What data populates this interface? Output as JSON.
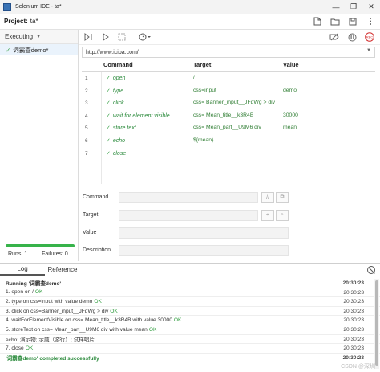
{
  "window": {
    "title": "Selenium IDE - ta*",
    "minimize": "—",
    "restore": "❐",
    "close": "✕"
  },
  "project": {
    "label": "Project:",
    "name": "ta*"
  },
  "sidebar": {
    "header": "Executing",
    "tests": [
      {
        "label": "词霸查demo*",
        "status": "passed"
      }
    ],
    "runs_label": "Runs: 1",
    "failures_label": "Failures: 0",
    "progress_fraction": 1.0
  },
  "url": {
    "value": "http://www.iciba.com/"
  },
  "table": {
    "headers": {
      "command": "Command",
      "target": "Target",
      "value": "Value"
    },
    "rows": [
      {
        "num": "1",
        "command": "open",
        "target": "/",
        "value": ""
      },
      {
        "num": "2",
        "command": "type",
        "target": "css=input",
        "value": "demo"
      },
      {
        "num": "3",
        "command": "click",
        "target": "css= Banner_input__JFqWg > div",
        "value": ""
      },
      {
        "num": "4",
        "command": "wait for element visible",
        "target": "css= Mean_title__k3R4B",
        "value": "30000"
      },
      {
        "num": "5",
        "command": "store text",
        "target": "css= Mean_part__U9M6 div",
        "value": "mean"
      },
      {
        "num": "6",
        "command": "echo",
        "target": "${mean}",
        "value": ""
      },
      {
        "num": "7",
        "command": "close",
        "target": "",
        "value": ""
      }
    ]
  },
  "editor": {
    "command_label": "Command",
    "target_label": "Target",
    "value_label": "Value",
    "description_label": "Description"
  },
  "log": {
    "tabs": [
      "Log",
      "Reference"
    ],
    "lines": [
      {
        "text": "Running '词霸查demo'",
        "ok": "",
        "time": "20:30:23",
        "style": "bold"
      },
      {
        "text": "1.   open on /",
        "ok": "OK",
        "time": "20:30:23",
        "style": ""
      },
      {
        "text": "2.   type on css=input with value demo",
        "ok": "OK",
        "time": "20:30:23",
        "style": ""
      },
      {
        "text": "3.   click on css=Banner_input__JFqWg > div",
        "ok": "OK",
        "time": "20:30:23",
        "style": ""
      },
      {
        "text": "4.   waitForElementVisible on css= Mean_title__k3R4B with value 30000",
        "ok": "OK",
        "time": "20:30:23",
        "style": ""
      },
      {
        "text": "5.   storeText on css= Mean_part__U9M6 div with value mean",
        "ok": "OK",
        "time": "20:30:23",
        "style": ""
      },
      {
        "text": "echo: 演示物; 示威（游行）; 试样唱片",
        "ok": "",
        "time": "20:30:23",
        "style": ""
      },
      {
        "text": "7.   close",
        "ok": "OK",
        "time": "20:30:23",
        "style": ""
      },
      {
        "text": "'词霸查demo' completed successfully",
        "ok": "",
        "time": "20:30:23",
        "style": "success"
      }
    ]
  },
  "watermark": "CSDN @深圳"
}
